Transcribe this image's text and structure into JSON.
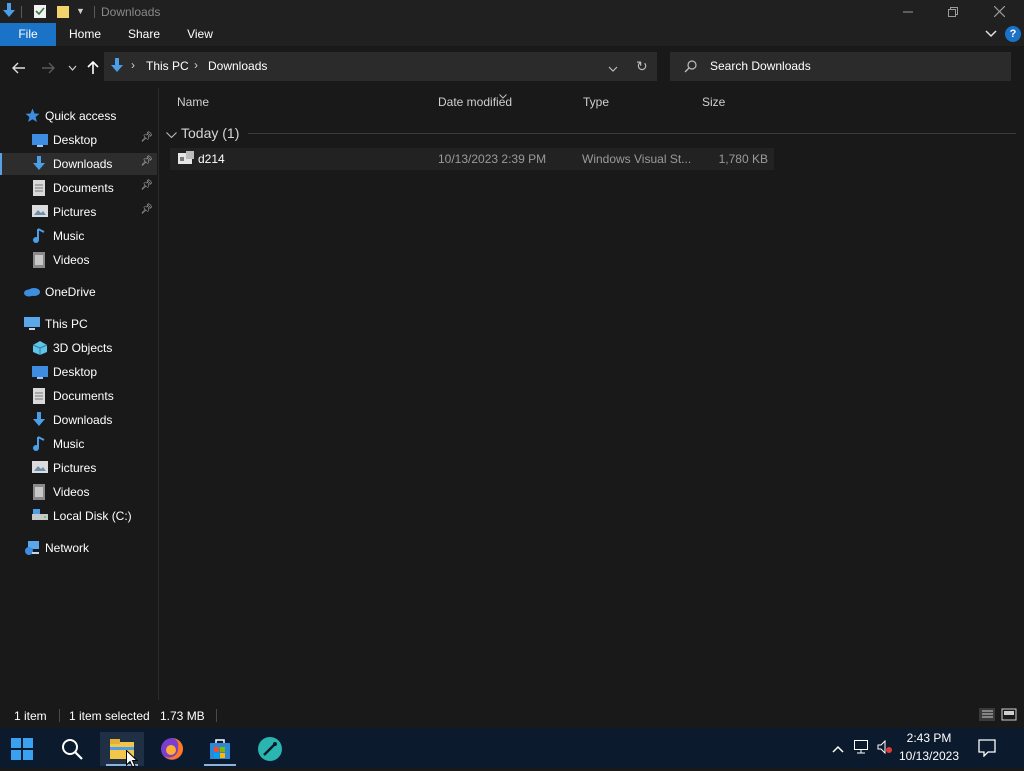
{
  "window": {
    "title": "Downloads"
  },
  "ribbon": {
    "tabs": [
      "File",
      "Home",
      "Share",
      "View"
    ],
    "help": "?"
  },
  "address": {
    "crumbs": [
      "This PC",
      "Downloads"
    ]
  },
  "search": {
    "placeholder": "Search Downloads"
  },
  "sidebar": {
    "quick_access": "Quick access",
    "quick_items": [
      {
        "label": "Desktop",
        "icon": "desktop-icon",
        "pinned": true
      },
      {
        "label": "Downloads",
        "icon": "download-arrow-icon",
        "pinned": true,
        "selected": true
      },
      {
        "label": "Documents",
        "icon": "document-icon",
        "pinned": true
      },
      {
        "label": "Pictures",
        "icon": "pictures-icon",
        "pinned": true
      },
      {
        "label": "Music",
        "icon": "music-note-icon",
        "pinned": false
      },
      {
        "label": "Videos",
        "icon": "video-icon",
        "pinned": false
      }
    ],
    "onedrive": "OneDrive",
    "this_pc": "This PC",
    "pc_items": [
      {
        "label": "3D Objects",
        "icon": "3d-objects-icon"
      },
      {
        "label": "Desktop",
        "icon": "desktop-icon"
      },
      {
        "label": "Documents",
        "icon": "document-icon"
      },
      {
        "label": "Downloads",
        "icon": "download-arrow-icon"
      },
      {
        "label": "Music",
        "icon": "music-note-icon"
      },
      {
        "label": "Pictures",
        "icon": "pictures-icon"
      },
      {
        "label": "Videos",
        "icon": "video-icon"
      },
      {
        "label": "Local Disk (C:)",
        "icon": "local-disk-icon"
      }
    ],
    "network": "Network"
  },
  "columns": {
    "name": "Name",
    "date": "Date modified",
    "type": "Type",
    "size": "Size"
  },
  "group": {
    "label": "Today (1)"
  },
  "files": [
    {
      "name": "d214",
      "date": "10/13/2023 2:39 PM",
      "type": "Windows Visual St...",
      "size": "1,780 KB"
    }
  ],
  "status": {
    "count": "1 item",
    "selected": "1 item selected",
    "size": "1.73 MB"
  },
  "taskbar": {
    "time": "2:43 PM",
    "date": "10/13/2023",
    "apps": [
      "start-icon",
      "search-icon",
      "file-explorer-icon",
      "firefox-icon",
      "store-icon",
      "app-icon"
    ]
  },
  "colors": {
    "accent": "#1a73c7",
    "background": "#191919",
    "taskbar": "#0b1a2c"
  }
}
